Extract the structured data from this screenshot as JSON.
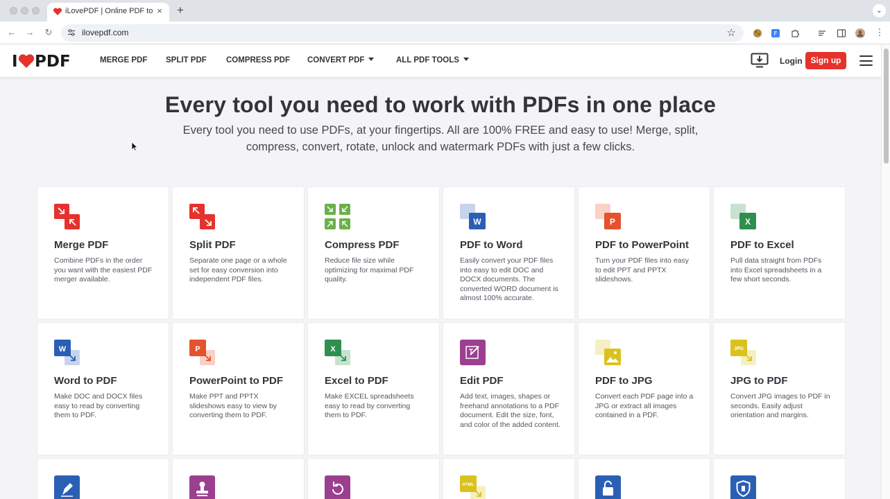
{
  "browser": {
    "tab_title": "iLovePDF | Online PDF tools f",
    "url": "ilovepdf.com",
    "new_tab": "+",
    "tab_close": "×"
  },
  "header": {
    "logo": "I❤PDF",
    "nav": [
      "MERGE PDF",
      "SPLIT PDF",
      "COMPRESS PDF",
      "CONVERT PDF",
      "ALL PDF TOOLS"
    ],
    "login": "Login",
    "signup": "Sign up"
  },
  "hero": {
    "title": "Every tool you need to work with PDFs in one place",
    "subtitle": "Every tool you need to use PDFs, at your fingertips. All are 100% FREE and easy to use! Merge, split, compress, convert, rotate, unlock and watermark PDFs with just a few clicks."
  },
  "tools": [
    {
      "title": "Merge PDF",
      "desc": "Combine PDFs in the order you want with the easiest PDF merger available.",
      "icon": "merge-icon",
      "color": "#e5322d"
    },
    {
      "title": "Split PDF",
      "desc": "Separate one page or a whole set for easy conversion into independent PDF files.",
      "icon": "split-icon",
      "color": "#e5322d"
    },
    {
      "title": "Compress PDF",
      "desc": "Reduce file size while optimizing for maximal PDF quality.",
      "icon": "compress-icon",
      "color": "#6ab04c"
    },
    {
      "title": "PDF to Word",
      "desc": "Easily convert your PDF files into easy to edit DOC and DOCX documents. The converted WORD document is almost 100% accurate.",
      "icon": "word-icon",
      "color": "#2b5fb4",
      "letter": "W"
    },
    {
      "title": "PDF to PowerPoint",
      "desc": "Turn your PDF files into easy to edit PPT and PPTX slideshows.",
      "icon": "powerpoint-icon",
      "color": "#e5522d",
      "letter": "P"
    },
    {
      "title": "PDF to Excel",
      "desc": "Pull data straight from PDFs into Excel spreadsheets in a few short seconds.",
      "icon": "excel-icon",
      "color": "#2f8f4e",
      "letter": "X"
    },
    {
      "title": "Word to PDF",
      "desc": "Make DOC and DOCX files easy to read by converting them to PDF.",
      "icon": "word-to-pdf-icon",
      "color": "#2b5fb4",
      "letter": "W"
    },
    {
      "title": "PowerPoint to PDF",
      "desc": "Make PPT and PPTX slideshows easy to view by converting them to PDF.",
      "icon": "powerpoint-to-pdf-icon",
      "color": "#e5522d",
      "letter": "P"
    },
    {
      "title": "Excel to PDF",
      "desc": "Make EXCEL spreadsheets easy to read by converting them to PDF.",
      "icon": "excel-to-pdf-icon",
      "color": "#2f8f4e",
      "letter": "X"
    },
    {
      "title": "Edit PDF",
      "desc": "Add text, images, shapes or freehand annotations to a PDF document. Edit the size, font, and color of the added content.",
      "icon": "edit-icon",
      "color": "#9b3f8f"
    },
    {
      "title": "PDF to JPG",
      "desc": "Convert each PDF page into a JPG or extract all images contained in a PDF.",
      "icon": "pdf-to-jpg-icon",
      "color": "#d9c21e"
    },
    {
      "title": "JPG to PDF",
      "desc": "Convert JPG images to PDF in seconds. Easily adjust orientation and margins.",
      "icon": "jpg-to-pdf-icon",
      "color": "#d9c21e",
      "letter": "JPG"
    },
    {
      "title": "",
      "desc": "",
      "icon": "sign-icon",
      "color": "#2b5fb4"
    },
    {
      "title": "",
      "desc": "",
      "icon": "watermark-icon",
      "color": "#9b3f8f"
    },
    {
      "title": "",
      "desc": "",
      "icon": "rotate-icon",
      "color": "#9b3f8f"
    },
    {
      "title": "",
      "desc": "",
      "icon": "html-to-pdf-icon",
      "color": "#d9c21e",
      "letter": "HTML"
    },
    {
      "title": "",
      "desc": "",
      "icon": "unlock-icon",
      "color": "#2b5fb4"
    },
    {
      "title": "",
      "desc": "",
      "icon": "protect-icon",
      "color": "#2b5fb4"
    }
  ]
}
